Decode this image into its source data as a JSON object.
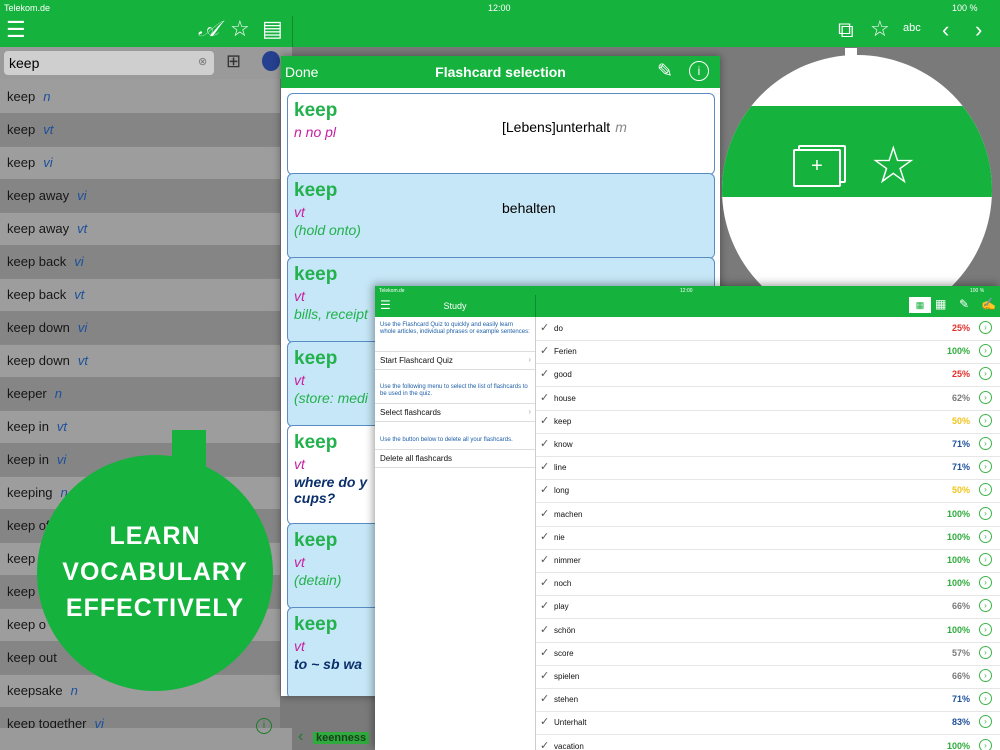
{
  "status": {
    "carrier": "Telekom.de",
    "time": "12:00",
    "battery": "100 %"
  },
  "search": {
    "value": "keep"
  },
  "entries": [
    {
      "word": "keep",
      "pos": "n"
    },
    {
      "word": "keep",
      "pos": "vt"
    },
    {
      "word": "keep",
      "pos": "vi"
    },
    {
      "word": "keep away",
      "pos": "vi"
    },
    {
      "word": "keep away",
      "pos": "vt"
    },
    {
      "word": "keep back",
      "pos": "vi"
    },
    {
      "word": "keep back",
      "pos": "vt"
    },
    {
      "word": "keep down",
      "pos": "vi"
    },
    {
      "word": "keep down",
      "pos": "vt"
    },
    {
      "word": "keeper",
      "pos": "n"
    },
    {
      "word": "keep in",
      "pos": "vt"
    },
    {
      "word": "keep in",
      "pos": "vi"
    },
    {
      "word": "keeping",
      "pos": "n"
    },
    {
      "word": "keep of",
      "pos": ""
    },
    {
      "word": "keep",
      "pos": ""
    },
    {
      "word": "keep",
      "pos": ""
    },
    {
      "word": "keep o",
      "pos": ""
    },
    {
      "word": "keep out",
      "pos": ""
    },
    {
      "word": "keepsake",
      "pos": "n"
    },
    {
      "word": "keep together",
      "pos": "vi"
    }
  ],
  "bottom_nav": {
    "label": "keenness"
  },
  "flashcards": {
    "done": "Done",
    "title": "Flashcard selection",
    "cards": [
      {
        "hw": "keep",
        "gram": "n no pl",
        "trans": "[Lebens]unterhalt",
        "gender": "m"
      },
      {
        "hw": "keep",
        "gram": "vt",
        "gloss": "(hold onto)",
        "trans": "behalten"
      },
      {
        "hw": "keep",
        "gram": "vt",
        "gloss": "bills, receipt"
      },
      {
        "hw": "keep",
        "gram": "vt",
        "gloss": "(store: medi"
      },
      {
        "hw": "keep",
        "gram": "vt",
        "ex1": "where do y",
        "ex2": "cups?"
      },
      {
        "hw": "keep",
        "gram": "vt",
        "gloss": "(detain)"
      },
      {
        "hw": "keep",
        "gram": "vt",
        "ex1": "to ~ sb wa"
      }
    ]
  },
  "promo": {
    "line1": "LEARN",
    "line2": "VOCABULARY",
    "line3": "EFFECTIVELY"
  },
  "study": {
    "status": {
      "carrier": "Telekom.de",
      "time": "12:00",
      "battery": "100 %"
    },
    "title": "Study",
    "note1": "Use the Flashcard Quiz to quickly and easily learn whole articles, individual phrases or example sentences:",
    "item1": "Start Flashcard Quiz",
    "note2": "Use the following menu to select the list of flashcards to be used in the quiz.",
    "item2": "Select flashcards",
    "note3": "Use the button below to delete all your flashcards.",
    "item3": "Delete all flashcards",
    "words": [
      {
        "w": "do",
        "p": "25%",
        "c": "#e0302a"
      },
      {
        "w": "Ferien",
        "p": "100%",
        "c": "#2eab3c"
      },
      {
        "w": "good",
        "p": "25%",
        "c": "#e0302a"
      },
      {
        "w": "house",
        "p": "62%",
        "c": "#7a7a7a"
      },
      {
        "w": "keep",
        "p": "50%",
        "c": "#f0c419"
      },
      {
        "w": "know",
        "p": "71%",
        "c": "#1d4e9a"
      },
      {
        "w": "line",
        "p": "71%",
        "c": "#1d4e9a"
      },
      {
        "w": "long",
        "p": "50%",
        "c": "#f0c419"
      },
      {
        "w": "machen",
        "p": "100%",
        "c": "#2eab3c"
      },
      {
        "w": "nie",
        "p": "100%",
        "c": "#2eab3c"
      },
      {
        "w": "nimmer",
        "p": "100%",
        "c": "#2eab3c"
      },
      {
        "w": "noch",
        "p": "100%",
        "c": "#2eab3c"
      },
      {
        "w": "play",
        "p": "66%",
        "c": "#7a7a7a"
      },
      {
        "w": "schön",
        "p": "100%",
        "c": "#2eab3c"
      },
      {
        "w": "score",
        "p": "57%",
        "c": "#7a7a7a"
      },
      {
        "w": "spielen",
        "p": "66%",
        "c": "#7a7a7a"
      },
      {
        "w": "stehen",
        "p": "71%",
        "c": "#1d4e9a"
      },
      {
        "w": "Unterhalt",
        "p": "83%",
        "c": "#1d4e9a"
      },
      {
        "w": "vacation",
        "p": "100%",
        "c": "#2eab3c"
      }
    ]
  }
}
